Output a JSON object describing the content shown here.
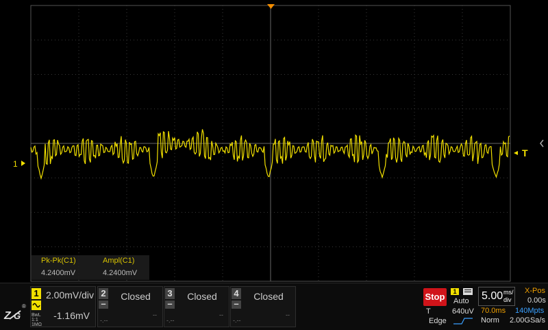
{
  "colors": {
    "trace": "#f2e000",
    "grid": "#3a3a3a",
    "trigger_marker": "#f28c00",
    "stop": "#d0141a",
    "blue": "#3aa0ff",
    "orange": "#f0a000"
  },
  "markers": {
    "channel_level": "1",
    "trigger_level": "T"
  },
  "measurements": [
    {
      "label": "Pk-Pk(C1)",
      "value": "4.2400mV"
    },
    {
      "label": "Ampl(C1)",
      "value": "4.2400mV"
    }
  ],
  "channels": [
    {
      "num": "1",
      "scale": "2.00mV/div",
      "offset": "-1.16mV",
      "mini1": "BwL",
      "mini2": "1:1",
      "mini3": "1MΩ",
      "dash": "-.--",
      "dash2": "--"
    },
    {
      "num": "2",
      "state": "Closed",
      "dash": "-.--",
      "dash2": "--"
    },
    {
      "num": "3",
      "state": "Closed",
      "dash": "-.--",
      "dash2": "--"
    },
    {
      "num": "4",
      "state": "Closed",
      "dash": "-.--",
      "dash2": "--"
    }
  ],
  "trigger": {
    "run_state": "Stop",
    "source": "1",
    "mode": "Auto",
    "type_label": "T",
    "level": "640uV",
    "edge": "Edge"
  },
  "timebase": {
    "scale_value": "5.00",
    "unit_top": "ms/",
    "unit_bottom": "div",
    "xpos_label": "X-Pos",
    "xpos_value": "0.00s",
    "delay": "70.0ms",
    "memory": "140Mpts",
    "acq_mode": "Norm",
    "sample_rate": "2.00GSa/s"
  },
  "icons": {
    "logo": "zlg-logo",
    "coupling": "ac-coupling-icon",
    "side": "collapse-arrow-icon"
  }
}
